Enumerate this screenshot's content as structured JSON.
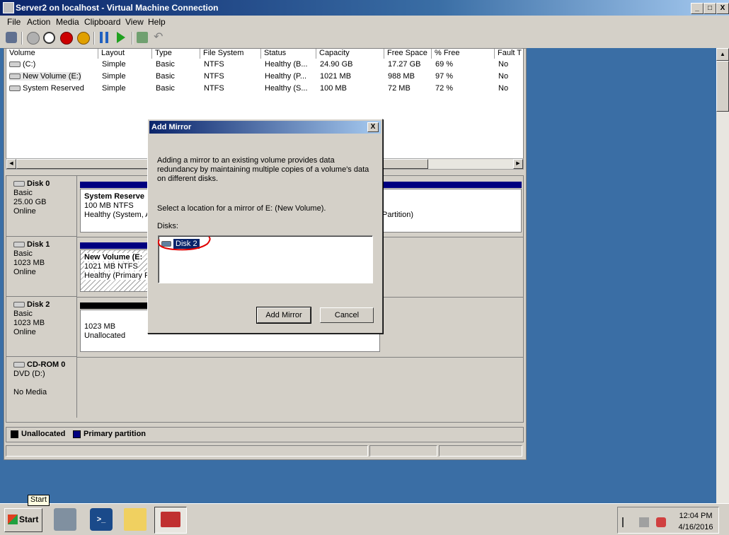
{
  "window": {
    "title": "Server2 on localhost - Virtual Machine Connection",
    "btn_min": "_",
    "btn_max": "□",
    "btn_close": "X"
  },
  "menu": [
    "File",
    "Action",
    "Media",
    "Clipboard",
    "View",
    "Help"
  ],
  "toolbar_icons": [
    "ctrl-alt-del-icon",
    "start-icon",
    "turn-off-icon",
    "shutdown-icon",
    "save-icon",
    "pause-icon",
    "play-icon",
    "checkpoint-icon",
    "revert-icon"
  ],
  "volumes": {
    "columns": [
      "Volume",
      "Layout",
      "Type",
      "File System",
      "Status",
      "Capacity",
      "Free Space",
      "% Free",
      "Fault T"
    ],
    "rows": [
      [
        "(C:)",
        "Simple",
        "Basic",
        "NTFS",
        "Healthy (B...",
        "24.90 GB",
        "17.27 GB",
        "69 %",
        "No"
      ],
      [
        "New Volume (E:)",
        "Simple",
        "Basic",
        "NTFS",
        "Healthy (P...",
        "1021 MB",
        "988 MB",
        "97 %",
        "No"
      ],
      [
        "System Reserved",
        "Simple",
        "Basic",
        "NTFS",
        "Healthy (S...",
        "100 MB",
        "72 MB",
        "72 %",
        "No"
      ]
    ]
  },
  "disks": {
    "disk0": {
      "name": "Disk 0",
      "type": "Basic",
      "size": "25.00 GB",
      "status": "Online",
      "part_name": "System Reserve",
      "part_size": "100 MB NTFS",
      "part_status": "Healthy (System, A",
      "part2_status": "Partition)"
    },
    "disk1": {
      "name": "Disk 1",
      "type": "Basic",
      "size": "1023 MB",
      "status": "Online",
      "part_name": "New Volume  (E:",
      "part_size": "1021 MB NTFS",
      "part_status": "Healthy (Primary P"
    },
    "disk2": {
      "name": "Disk 2",
      "type": "Basic",
      "size": "1023 MB",
      "status": "Online",
      "part_size": "1023 MB",
      "part_status": "Unallocated"
    },
    "cdrom0": {
      "name": "CD-ROM 0",
      "type": "DVD (D:)",
      "status": "No Media"
    }
  },
  "legend": {
    "unallocated": "Unallocated",
    "primary": "Primary partition"
  },
  "dialog": {
    "title": "Add Mirror",
    "close": "X",
    "description": "Adding a mirror to an existing volume provides data redundancy by maintaining multiple copies of a volume's data on different disks.",
    "prompt": "Select a location for a mirror of E: (New Volume).",
    "disks_label": "Disks:",
    "disk_items": [
      "Disk 2"
    ],
    "ok_label": "Add Mirror",
    "cancel_label": "Cancel"
  },
  "taskbar": {
    "start_label": "Start",
    "start_tooltip": "Start",
    "time": "12:04 PM",
    "date": "4/16/2016"
  },
  "colors": {
    "title_blue": "#0a246a",
    "desktop": "#3a6ea5",
    "partition_blue": "#000080",
    "annotation_red": "#e00000"
  }
}
